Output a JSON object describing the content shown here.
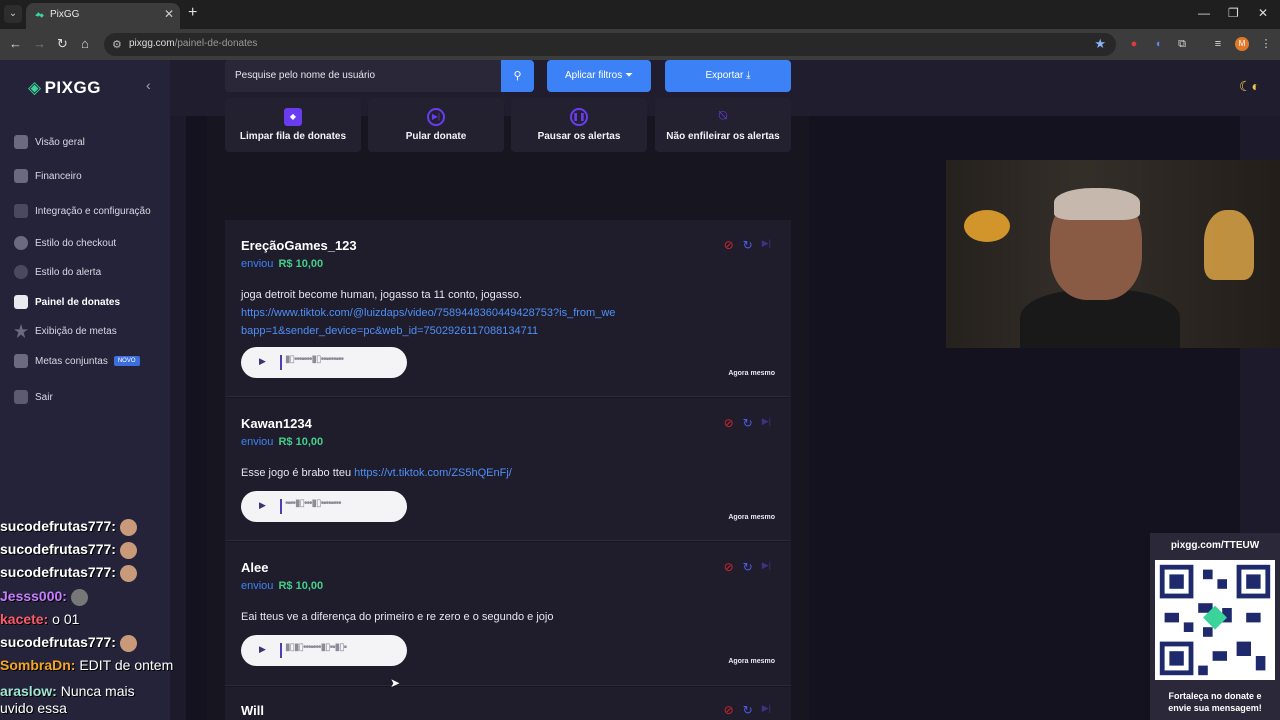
{
  "browser": {
    "tab_title": "PixGG",
    "url_domain": "pixgg.com",
    "url_path": "/painel-de-donates",
    "avatar_letter": "M"
  },
  "sidebar": {
    "logo": "PIXGG",
    "items": [
      {
        "label": "Visão geral"
      },
      {
        "label": "Financeiro"
      },
      {
        "label": "Integração e configuração"
      },
      {
        "label": "Estilo do checkout"
      },
      {
        "label": "Estilo do alerta"
      },
      {
        "label": "Painel de donates"
      },
      {
        "label": "Exibição de metas"
      },
      {
        "label": "Metas conjuntas",
        "badge": "NOVO"
      },
      {
        "label": "Sair"
      }
    ]
  },
  "toolbar": {
    "search_placeholder": "Pesquise pelo nome de usuário",
    "filter_label": "Aplicar filtros",
    "export_label": "Exportar"
  },
  "actions": [
    {
      "label": "Limpar fila de donates",
      "icon": "eraser-icon"
    },
    {
      "label": "Pular donate",
      "icon": "skip-icon"
    },
    {
      "label": "Pausar os alertas",
      "icon": "pause-icon"
    },
    {
      "label": "Não enfileirar os alertas",
      "icon": "bell-off-icon"
    }
  ],
  "donations": [
    {
      "name": "EreçãoGames_123",
      "sent_label": "enviou",
      "amount": "R$ 10,00",
      "message": "joga detroit become human, jogasso ta 11 conto, jogasso.",
      "link": "https://www.tiktok.com/@luizdaps/video/7589448360449428753?is_from_webapp=1&sender_device=pc&web_id=7502926117088134711",
      "time": "Agora mesmo"
    },
    {
      "name": "Kawan1234",
      "sent_label": "enviou",
      "amount": "R$ 10,00",
      "message": "Esse jogo é brabo tteu",
      "link": "https://vt.tiktok.com/ZS5hQEnFj/",
      "time": "Agora mesmo"
    },
    {
      "name": "Alee",
      "sent_label": "enviou",
      "amount": "R$ 10,00",
      "message": "Eai tteus ve a diferença do primeiro e re zero e o segundo e jojo",
      "link": "",
      "time": "Agora mesmo"
    },
    {
      "name": "Will",
      "sent_label": "",
      "amount": "",
      "message": "",
      "link": "",
      "time": ""
    }
  ],
  "chat": [
    {
      "user": "sucodefrutas777:",
      "msg": "",
      "color": "#ffffff"
    },
    {
      "user": "sucodefrutas777:",
      "msg": "",
      "color": "#ffffff"
    },
    {
      "user": "sucodefrutas777:",
      "msg": "",
      "color": "#ffffff"
    },
    {
      "user": "Jesss000:",
      "msg": "",
      "color": "#c77dff"
    },
    {
      "user": "kacete:",
      "msg": "o 01",
      "color": "#ff5a6a"
    },
    {
      "user": "sucodefrutas777:",
      "msg": "",
      "color": "#ffffff"
    },
    {
      "user": "SombraDn:",
      "msg": "EDIT de ontem",
      "color": "#f5a623"
    },
    {
      "user": "araslow:",
      "msg": "Nunca mais",
      "color": "#9fe7d4"
    },
    {
      "user": "",
      "msg": "uvido essa",
      "color": "#ffffff"
    }
  ],
  "qr_widget": {
    "title": "pixgg.com/TTEUW",
    "footer_line1": "Fortaleça no donate e",
    "footer_line2": "envie sua mensagem!"
  }
}
